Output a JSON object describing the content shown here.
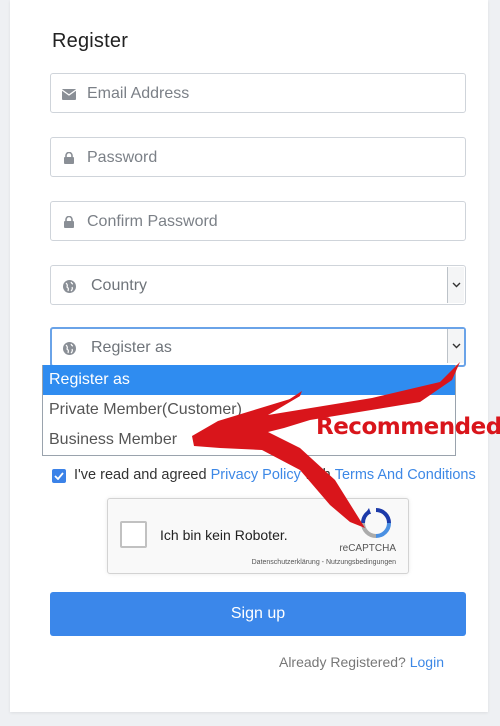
{
  "form": {
    "title": "Register",
    "email_placeholder": "Email Address",
    "password_placeholder": "Password",
    "confirm_placeholder": "Confirm Password",
    "country_placeholder": "Country",
    "register_as_value": "Register as"
  },
  "dropdown": {
    "options": [
      "Register as",
      "Private Member(Customer)",
      "Business Member"
    ],
    "selected": "Register as"
  },
  "agreement": {
    "prefix": "I've read and agreed ",
    "privacy_link": "Privacy Policy",
    "middle": " with ",
    "terms_link": "Terms And Conditions",
    "checked": true
  },
  "captcha": {
    "label": "Ich bin kein Roboter.",
    "brand": "reCAPTCHA",
    "links": "Datenschutzerklärung - Nutzungsbedingungen"
  },
  "actions": {
    "signup_label": "Sign up",
    "already_text": "Already Registered?",
    "login_link": "Login"
  },
  "annotation": {
    "label": "Recommended",
    "color": "#d9151b"
  },
  "colors": {
    "accent": "#3b87ea",
    "dropdown_highlight": "#2f8cf0"
  }
}
